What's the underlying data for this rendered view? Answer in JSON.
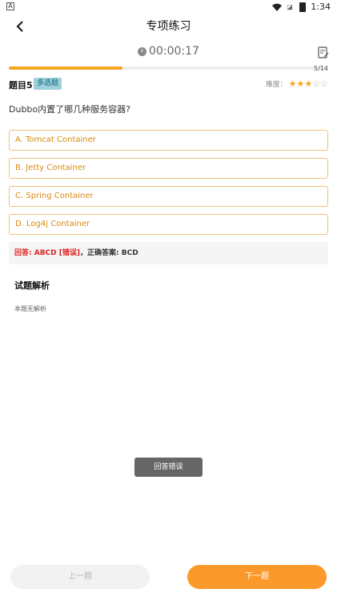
{
  "status_bar": {
    "left_icon": "A",
    "sim_icon": "sim-icon",
    "time": "1:34"
  },
  "nav": {
    "title": "专项练习"
  },
  "timer": {
    "value": "00:00:17"
  },
  "progress": {
    "current": 5,
    "total": 14,
    "text": "5/14"
  },
  "question": {
    "number_label": "题目5",
    "type_badge": "多选题",
    "difficulty_label": "难度：",
    "difficulty_stars": 3,
    "difficulty_max": 5,
    "text": "Dubbo内置了哪几种服务容器?"
  },
  "options": [
    {
      "label": "A. Tomcat Container"
    },
    {
      "label": "B. Jetty Container"
    },
    {
      "label": "C. Spring Container"
    },
    {
      "label": "D. Log4j Container"
    }
  ],
  "result": {
    "answer_prefix": "回答: ABCD [错误]",
    "separator": "，",
    "correct_label": "正确答案: BCD"
  },
  "analysis": {
    "title": "试题解析",
    "body": "本题无解析"
  },
  "toast": {
    "text": "回答错误"
  },
  "buttons": {
    "prev": "上一题",
    "next": "下一题"
  },
  "colors": {
    "accent": "#f5a623",
    "option_border": "#f0c27a",
    "option_text": "#d88a0e",
    "wrong": "#e02020",
    "badge_bg": "#9ed0d9",
    "next_button": "#fb9a2a"
  },
  "icons": {
    "back": "back-arrow-icon",
    "timer": "clock-icon",
    "answer_sheet": "answer-sheet-icon",
    "wifi": "wifi-icon",
    "battery": "battery-icon"
  }
}
